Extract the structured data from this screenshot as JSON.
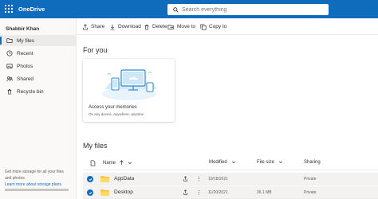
{
  "app": {
    "title": "OneDrive"
  },
  "search": {
    "placeholder": "Search everything"
  },
  "sidebar": {
    "user_name": "Shabbir Khan",
    "items": [
      {
        "label": "My files",
        "icon": "folder-icon",
        "active": true
      },
      {
        "label": "Recent",
        "icon": "clock-icon",
        "active": false
      },
      {
        "label": "Photos",
        "icon": "image-icon",
        "active": false
      },
      {
        "label": "Shared",
        "icon": "people-icon",
        "active": false
      },
      {
        "label": "Recycle bin",
        "icon": "trash-icon",
        "active": false
      }
    ],
    "storage_text": "Get more storage for all your files and photos.",
    "storage_link": "Learn more about storage plans."
  },
  "toolbar": {
    "share_label": "Share",
    "download_label": "Download",
    "delete_label": "Delete",
    "move_label": "Move to",
    "copy_label": "Copy to"
  },
  "for_you": {
    "heading": "For you",
    "card_title": "Access your memories",
    "card_subtitle": "On any device, anywhere, anytime"
  },
  "files": {
    "heading": "My files",
    "columns": {
      "name": "Name",
      "modified": "Modified",
      "size": "File size",
      "sharing": "Sharing"
    },
    "rows": [
      {
        "name": "AppData",
        "modified": "10/18/2021",
        "size": "",
        "sharing": "Private",
        "selected": true
      },
      {
        "name": "Desktop",
        "modified": "11/20/2021",
        "size": "36.1 MB",
        "sharing": "Private",
        "selected": true
      }
    ]
  },
  "colors": {
    "accent": "#0f6cbd",
    "folder": "#f5c342"
  }
}
